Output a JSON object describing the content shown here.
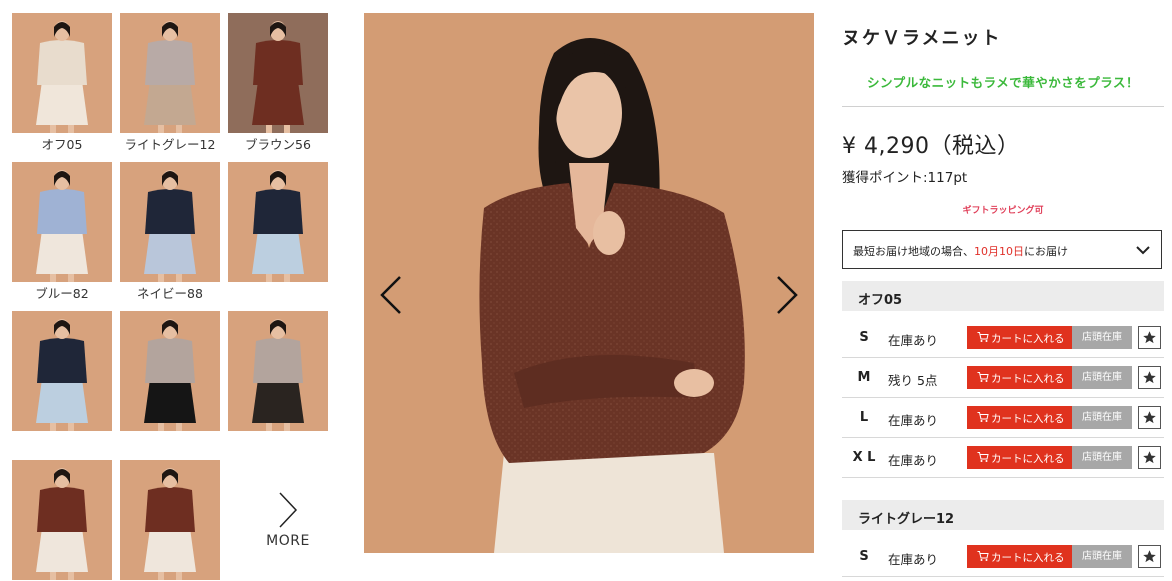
{
  "thumbnails": [
    {
      "label": "オフ05",
      "bg": "#d7a27d",
      "top": "#e8dccd",
      "bottom": "#f0e6da"
    },
    {
      "label": "ライトグレー12",
      "bg": "#d7a27d",
      "top": "#b8aaa6",
      "bottom": "#c3a891"
    },
    {
      "label": "ブラウン56",
      "bg": "#8f6d5b",
      "top": "#6e2e21",
      "bottom": "#6e2e21"
    },
    {
      "label": "ブルー82",
      "bg": "#d7a27d",
      "top": "#9fb2d4",
      "bottom": "#efe6dc"
    },
    {
      "label": "ネイビー88",
      "bg": "#d7a27d",
      "top": "#1f2638",
      "bottom": "#b9c6da"
    },
    {
      "label": "",
      "bg": "#d7a27d",
      "top": "#1f2638",
      "bottom": "#bccfe0"
    },
    {
      "label": "",
      "bg": "#d7a27d",
      "top": "#1f2638",
      "bottom": "#bccfe0"
    },
    {
      "label": "",
      "bg": "#d7a27d",
      "top": "#b3a49d",
      "bottom": "#151515"
    },
    {
      "label": "",
      "bg": "#d7a27d",
      "top": "#b3a49d",
      "bottom": "#2a2420"
    },
    {
      "label": "",
      "bg": "#d7a27d",
      "top": "#6e2e21",
      "bottom": "#efe6dc"
    },
    {
      "label": "",
      "bg": "#d7a27d",
      "top": "#6e2e21",
      "bottom": "#efe6dc"
    }
  ],
  "more_label": "MORE",
  "product": {
    "title": "ヌケＶラメニット",
    "catch": "シンプルなニットもラメで華やかさをプラス！",
    "price": "¥ 4,290（税込）",
    "points": "獲得ポイント:117pt",
    "gift": "ギフトラッピング可",
    "delivery_prefix": "最短お届け地域の場合、",
    "delivery_date": "10月10日",
    "delivery_suffix": "にお届け"
  },
  "colors": [
    {
      "name": "オフ05",
      "sizes": [
        {
          "size": "S",
          "stock": "在庫あり"
        },
        {
          "size": "M",
          "stock": "残り 5点"
        },
        {
          "size": "L",
          "stock": "在庫あり"
        },
        {
          "size": "X L",
          "stock": "在庫あり"
        }
      ]
    },
    {
      "name": "ライトグレー12",
      "sizes": [
        {
          "size": "S",
          "stock": "在庫あり"
        }
      ]
    }
  ],
  "buttons": {
    "cart": "カートに入れる",
    "store": "店頭在庫"
  },
  "main_image": {
    "alt": "model wearing brown V-neck lame knit"
  },
  "colors_palette": {
    "accent_red": "#e0321e",
    "catch_green": "#3bb93b",
    "gift_pink": "#e0405a"
  }
}
